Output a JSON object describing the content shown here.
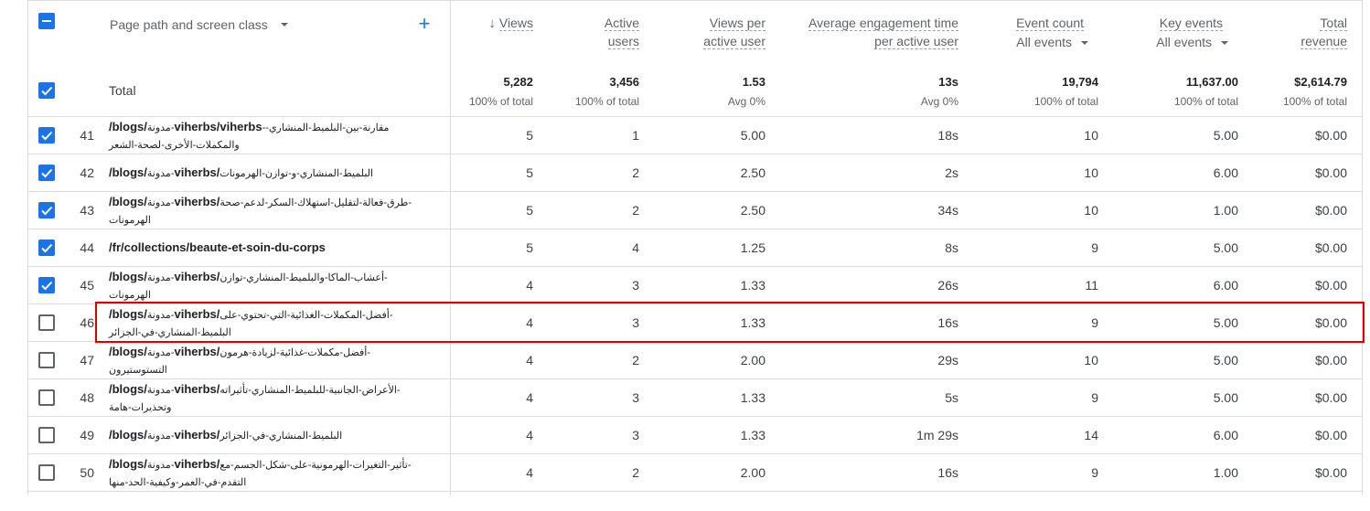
{
  "header": {
    "dimension_label": "Page path and screen class",
    "add_label": "+",
    "columns": [
      {
        "line1": "Views",
        "line2": "",
        "sorted": true
      },
      {
        "line1": "Active",
        "line2": "users"
      },
      {
        "line1": "Views per",
        "line2": "active user"
      },
      {
        "line1": "Average engagement time",
        "line2": "per active user"
      },
      {
        "line1": "Event count",
        "line2": "",
        "filter": "All events"
      },
      {
        "line1": "Key events",
        "line2": "",
        "filter": "All events"
      },
      {
        "line1": "Total",
        "line2": "revenue"
      }
    ]
  },
  "totals": {
    "label": "Total",
    "values": [
      "5,282",
      "3,456",
      "1.53",
      "13s",
      "19,794",
      "11,637.00",
      "$2,614.79"
    ],
    "subs": [
      "100% of total",
      "100% of total",
      "Avg 0%",
      "Avg 0%",
      "100% of total",
      "100% of total",
      "100% of total"
    ]
  },
  "rows": [
    {
      "n": "41",
      "checked": true,
      "bold": "/blogs/",
      "ar": "مدونة-",
      "mid": "viherbs/viherbs",
      "rest": "--مقارنة-بين-البلميط-المنشاري",
      "line2": "والمكملات-الأخرى-لصحة-الشعر",
      "cells": [
        "5",
        "1",
        "5.00",
        "18s",
        "10",
        "5.00",
        "$0.00"
      ]
    },
    {
      "n": "42",
      "checked": true,
      "bold": "/blogs/",
      "ar": "مدونة-",
      "mid": "viherbs/",
      "rest": "البلميط-المنشاري-و-توازن-الهرمونات",
      "line2": "",
      "cells": [
        "5",
        "2",
        "2.50",
        "2s",
        "10",
        "6.00",
        "$0.00"
      ]
    },
    {
      "n": "43",
      "checked": true,
      "bold": "/blogs/",
      "ar": "مدونة-",
      "mid": "viherbs/",
      "rest": "طرق-فعالة-لتقليل-استهلاك-السكر-لدعم-صحة-",
      "line2": "الهرمونات",
      "cells": [
        "5",
        "2",
        "2.50",
        "34s",
        "10",
        "1.00",
        "$0.00"
      ]
    },
    {
      "n": "44",
      "checked": true,
      "bold": "/fr/collections/beaute-et-soin-du-corps",
      "ar": "",
      "mid": "",
      "rest": "",
      "line2": "",
      "cells": [
        "5",
        "4",
        "1.25",
        "8s",
        "9",
        "5.00",
        "$0.00"
      ]
    },
    {
      "n": "45",
      "checked": true,
      "bold": "/blogs/",
      "ar": "مدونة-",
      "mid": "viherbs/",
      "rest": "أعشاب-الماكا-والبلميط-المنشاري-توازن-",
      "line2": "الهرمونات",
      "cells": [
        "4",
        "3",
        "1.33",
        "26s",
        "11",
        "6.00",
        "$0.00"
      ]
    },
    {
      "n": "46",
      "checked": false,
      "bold": "/blogs/",
      "ar": "مدونة-",
      "mid": "viherbs/",
      "rest": "أفضل-المكملات-الغذائية-التي-تحتوي-على-",
      "line2": "البلميط-المنشاري-في-الجزائر",
      "cells": [
        "4",
        "3",
        "1.33",
        "16s",
        "9",
        "5.00",
        "$0.00"
      ]
    },
    {
      "n": "47",
      "checked": false,
      "bold": "/blogs/",
      "ar": "مدونة-",
      "mid": "viherbs/",
      "rest": "أفضل-مكملات-غذائية-لزيادة-هرمون-",
      "line2": "التستوستيرون",
      "cells": [
        "4",
        "2",
        "2.00",
        "29s",
        "10",
        "5.00",
        "$0.00"
      ]
    },
    {
      "n": "48",
      "checked": false,
      "bold": "/blogs/",
      "ar": "مدونة-",
      "mid": "viherbs/",
      "rest": "الأعراض-الجانبية-للبلميط-المنشاري-تأثيراته-",
      "line2": "وتحذيرات-هامة",
      "cells": [
        "4",
        "3",
        "1.33",
        "5s",
        "9",
        "5.00",
        "$0.00"
      ]
    },
    {
      "n": "49",
      "checked": false,
      "bold": "/blogs/",
      "ar": "مدونة-",
      "mid": "viherbs/",
      "rest": "البلميط-المنشاري-في-الجزائر",
      "line2": "",
      "cells": [
        "4",
        "3",
        "1.33",
        "1m 29s",
        "14",
        "6.00",
        "$0.00"
      ]
    },
    {
      "n": "50",
      "checked": false,
      "bold": "/blogs/",
      "ar": "مدونة-",
      "mid": "viherbs/",
      "rest": "تأثير-التغيرات-الهرمونية-على-شكل-الجسم-مع-",
      "line2": "التقدم-في-العمر-وكيفية-الحد-منها",
      "cells": [
        "4",
        "2",
        "2.00",
        "16s",
        "9",
        "1.00",
        "$0.00"
      ]
    }
  ],
  "highlight_row": "46",
  "colors": {
    "accent": "#1a73e8",
    "highlight": "#e00000",
    "divider": "#dadce0"
  }
}
